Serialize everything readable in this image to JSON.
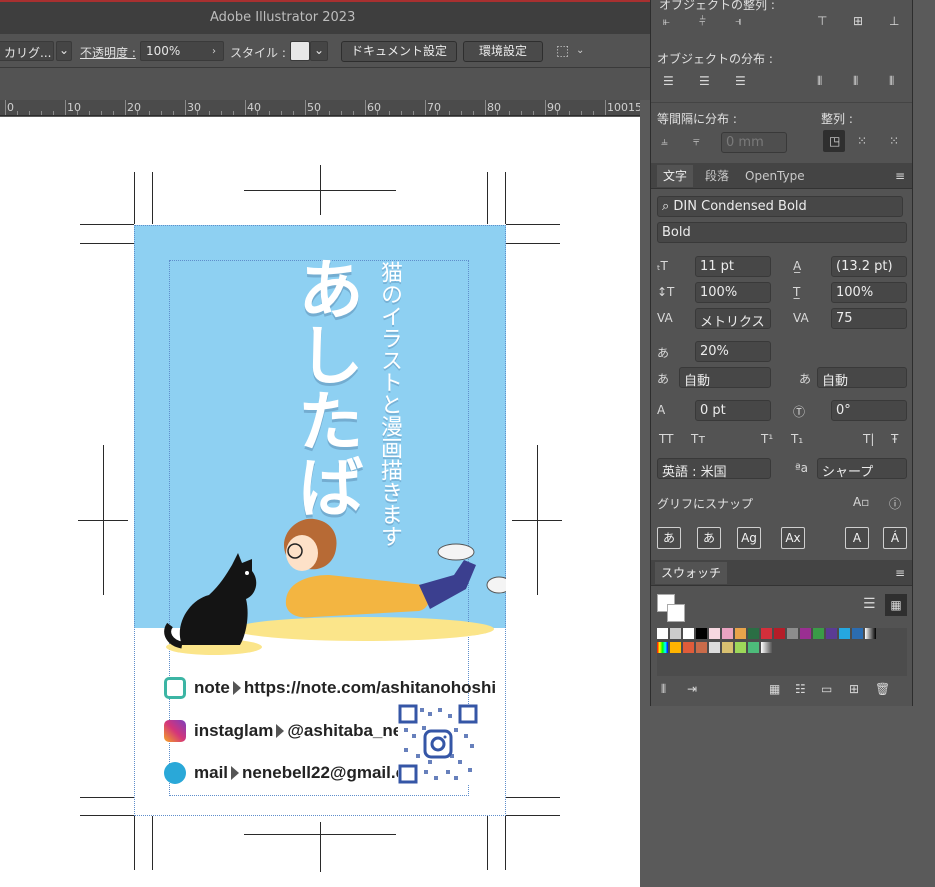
{
  "app": {
    "title": "Adobe Illustrator 2023"
  },
  "control_bar": {
    "style_dropdown_value": "カリグ...",
    "opacity_label": "不透明度 :",
    "opacity_value": "100%",
    "style_label": "スタイル :",
    "document_settings_button": "ドキュメント設定",
    "preferences_button": "環境設定"
  },
  "ruler": {
    "marks": [
      "0",
      "10",
      "20",
      "30",
      "40",
      "50",
      "60",
      "70",
      "80",
      "90",
      "100",
      "15"
    ]
  },
  "card": {
    "title": "あしたば",
    "subtitle": "猫のイラストと漫画描きます",
    "rows": [
      {
        "icon": "note-icon",
        "label": "note",
        "value": "https://note.com/ashitanohoshi"
      },
      {
        "icon": "instagram-icon",
        "label": "instaglam",
        "value": "@ashitaba_neko"
      },
      {
        "icon": "mail-icon",
        "label": "mail",
        "value": "nenebell22@gmail.com"
      }
    ],
    "colors": {
      "sky": "#8ed0f2",
      "note": "#3cb5a4",
      "mail": "#2aa8d8",
      "insta": "#d4357a"
    }
  },
  "panel": {
    "align_header": "オブジェクトの整列 :",
    "distribute_header": "オブジェクトの分布 :",
    "spacing_header": "等間隔に分布 :",
    "align_to_header": "整列 :",
    "spacing_value": "0 mm",
    "tabs": [
      "文字",
      "段落",
      "OpenType"
    ],
    "font_family": "DIN Condensed Bold",
    "font_style": "Bold",
    "font_size": "11 pt",
    "leading": "(13.2 pt)",
    "vertical_scale": "100%",
    "horizontal_scale": "100%",
    "kerning": "メトリクス",
    "tracking": "75",
    "tsume": "20%",
    "aki_left": "自動",
    "aki_right": "自動",
    "baseline_shift": "0 pt",
    "rotation": "0°",
    "caps_buttons": [
      "TT",
      "Tт",
      "T¹",
      "T₁",
      "T|",
      "Ŧ"
    ],
    "language": "英語 : 米国",
    "antialias": "シャープ",
    "snap_label": "グリフにスナップ",
    "glyph_buttons": [
      "あ",
      "あ",
      "Ag",
      "Ax",
      "A",
      "Á"
    ],
    "swatches_tab": "スウォッチ"
  }
}
